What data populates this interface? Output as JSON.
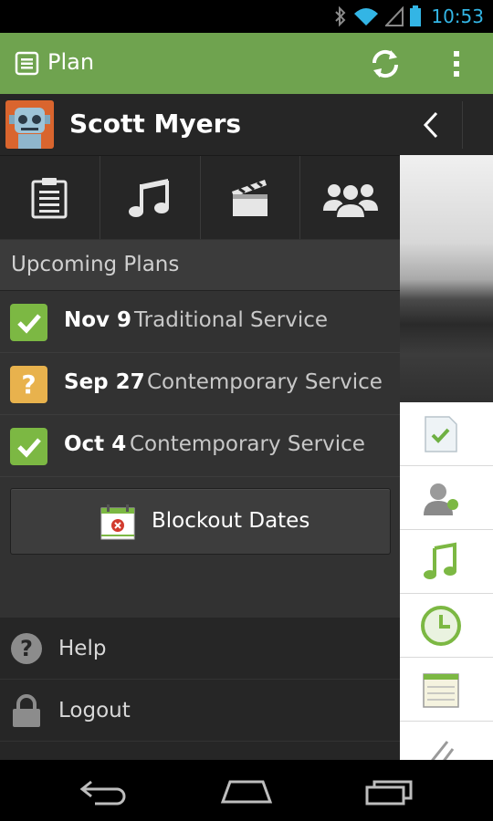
{
  "status_bar": {
    "time": "10:53"
  },
  "action_bar": {
    "title": "Plan"
  },
  "profile": {
    "name": "Scott Myers"
  },
  "tabs": [
    {
      "icon": "clipboard-icon"
    },
    {
      "icon": "music-note-icon"
    },
    {
      "icon": "clapperboard-icon"
    },
    {
      "icon": "people-icon"
    }
  ],
  "upcoming": {
    "header": "Upcoming Plans",
    "plans": [
      {
        "date": "Nov 9",
        "title": "Traditional Service",
        "status": "confirmed"
      },
      {
        "date": "Sep 27",
        "title": "Contemporary Service",
        "status": "pending"
      },
      {
        "date": "Oct 4",
        "title": "Contemporary Service",
        "status": "confirmed"
      }
    ]
  },
  "blockout": {
    "label": "Blockout Dates"
  },
  "footer": {
    "help": "Help",
    "logout": "Logout"
  },
  "colors": {
    "action_bar": "#6fa34f",
    "confirmed": "#7cb843",
    "pending": "#e8b24d",
    "clock": "#33b5e5"
  }
}
